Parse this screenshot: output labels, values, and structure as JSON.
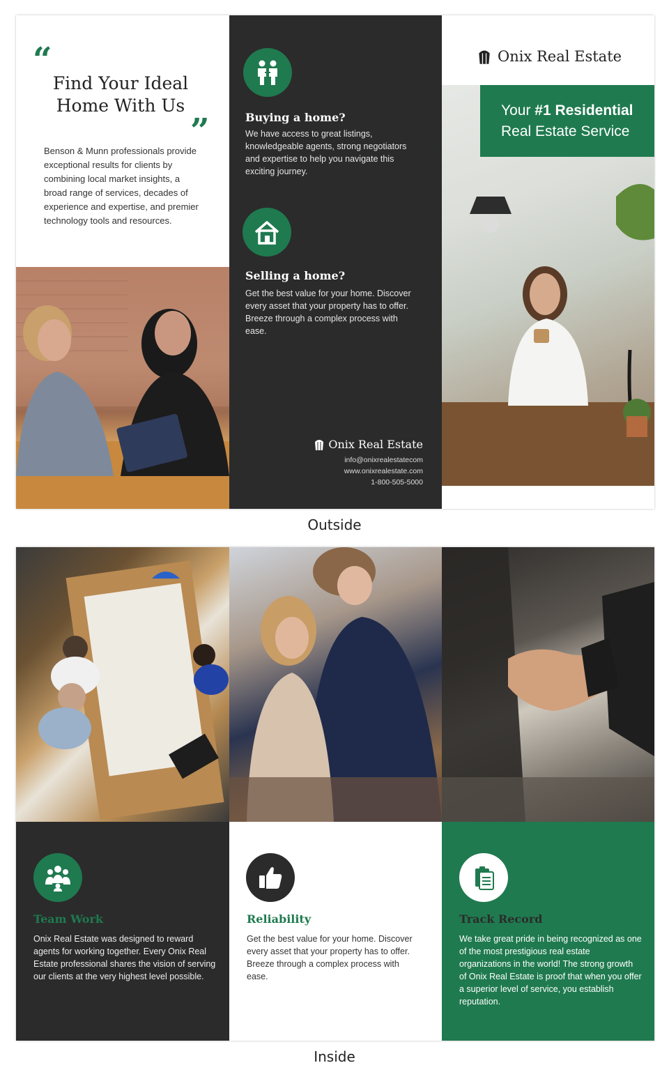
{
  "brand": {
    "name": "Onix Real Estate",
    "accent": "#1f7a4f",
    "dark": "#2b2b2b"
  },
  "outside": {
    "caption": "Outside",
    "panel1": {
      "headline_line1": "Find Your Ideal",
      "headline_line2": "Home With Us",
      "body": "Benson & Munn professionals provide exceptional results for clients by combining local market insights, a broad range of services, decades of experience and expertise, and premier technology tools and resources."
    },
    "panel2": {
      "buying_title": "Buying a home?",
      "buying_text": "We have access to great listings, knowledgeable agents, strong negotiators and expertise to help you navigate this exciting journey.",
      "selling_title": "Selling a home?",
      "selling_text": "Get the best value for your home. Discover every asset that your property has to offer. Breeze through a complex process with ease.",
      "contact_brand": "Onix Real Estate",
      "email": "info@onixrealestatecom",
      "website": "www.onixrealestate.com",
      "phone": "1-800-505-5000"
    },
    "panel3": {
      "brand": "Onix Real Estate",
      "tagline_prefix": "Your ",
      "tagline_bold": "#1 Residential",
      "tagline_line2": "Real Estate Service"
    }
  },
  "inside": {
    "caption": "Inside",
    "team": {
      "title": "Team Work",
      "text": "Onix Real Estate was designed to reward agents for working together. Every Onix Real Estate  professional shares the vision of serving our clients at the very highest level possible."
    },
    "reliability": {
      "title": "Reliability",
      "text": "Get the best value for your home. Discover every asset that your property has to offer. Breeze through a complex process with ease."
    },
    "track": {
      "title": "Track Record",
      "text": "We take great pride in being recognized as one of the most prestigious real estate organizations in the world! The strong growth of Onix Real Estate is proof that when you offer a superior level of service, you establish reputation."
    }
  },
  "icons": [
    "quote-open-icon",
    "quote-close-icon",
    "people-icon",
    "house-icon",
    "building-logo-icon",
    "group-icon",
    "thumbs-up-icon",
    "clipboard-icon"
  ]
}
